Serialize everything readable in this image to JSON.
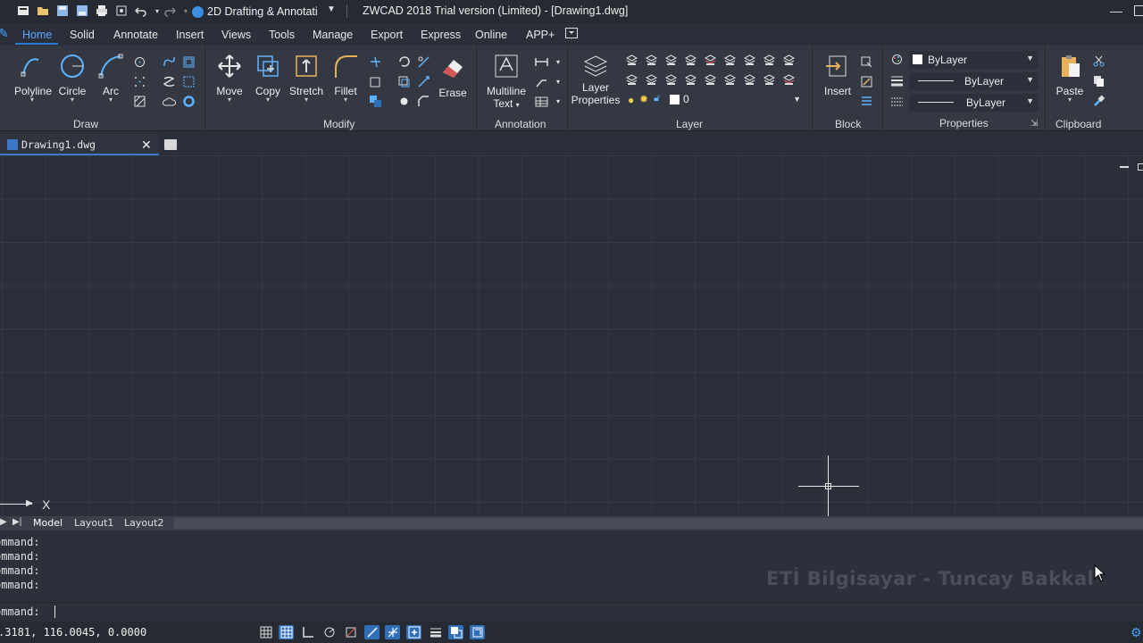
{
  "window": {
    "title": "ZWCAD 2018 Trial version (Limited) - [Drawing1.dwg]",
    "workspace": "2D Drafting & Annotati"
  },
  "ribbon_tabs": [
    "Home",
    "Solid",
    "Annotate",
    "Insert",
    "Views",
    "Tools",
    "Manage",
    "Export",
    "Express",
    "Online",
    "APP+"
  ],
  "active_tab": "Home",
  "panels": {
    "draw": {
      "label": "Draw",
      "buttons": {
        "polyline": "Polyline",
        "circle": "Circle",
        "arc": "Arc"
      }
    },
    "modify": {
      "label": "Modify",
      "buttons": {
        "move": "Move",
        "copy": "Copy",
        "stretch": "Stretch",
        "fillet": "Fillet",
        "erase": "Erase"
      }
    },
    "annotation": {
      "label": "Annotation",
      "buttons": {
        "mtext_line1": "Multiline",
        "mtext_line2": "Text"
      }
    },
    "layer": {
      "label": "Layer",
      "buttons": {
        "props_line1": "Layer",
        "props_line2": "Properties"
      },
      "current_layer": "0"
    },
    "block": {
      "label": "Block",
      "buttons": {
        "insert": "Insert"
      }
    },
    "properties": {
      "label": "Properties",
      "color": "ByLayer",
      "linetype": "ByLayer",
      "lineweight": "ByLayer"
    },
    "clipboard": {
      "label": "Clipboard",
      "buttons": {
        "paste": "Paste"
      }
    }
  },
  "document": {
    "tab_name": "Drawing1.dwg"
  },
  "canvas": {
    "ucs_x_label": "X"
  },
  "layout_tabs": [
    "Model",
    "Layout1",
    "Layout2"
  ],
  "command": {
    "history": [
      "ommand:",
      "ommand:",
      "ommand:",
      "ommand:"
    ],
    "prompt": "ommand:",
    "watermark": "ETİ Bilgisayar - Tuncay Bakkal"
  },
  "status": {
    "coordinates": ".3181, 116.0045, 0.0000"
  },
  "colors": {
    "accent": "#2d7ad6",
    "canvas_bg": "#2b2f3a",
    "ribbon_bg": "#343843"
  }
}
